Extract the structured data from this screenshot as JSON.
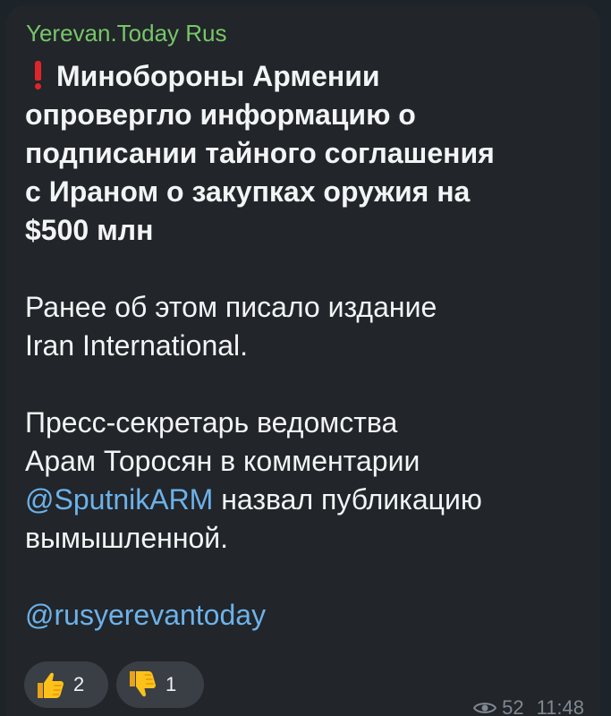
{
  "channel": {
    "name": "Yerevan.Today Rus",
    "name_color": "#77c66a"
  },
  "message": {
    "alert_icon": "red-exclamation-icon",
    "headline_lines": [
      "Минобороны Армении",
      "опровергло информацию о",
      "подписании тайного соглашения",
      "с Ираном о закупках оружия на",
      "$500 млн"
    ],
    "para2_lines": [
      "Ранее об этом писало издание",
      "Iran International."
    ],
    "para3": {
      "line1": "Пресс-секретарь ведомства",
      "line2": "Арам Торосян в комментарии",
      "mention": "@SputnikARM",
      "line3_rest": " назвал публикацию",
      "line4": "вымышленной."
    },
    "signature": "@rusyerevantoday",
    "link_color": "#6cb2ea"
  },
  "reactions": [
    {
      "icon": "thumbs-up-icon",
      "count": "2"
    },
    {
      "icon": "thumbs-down-icon",
      "count": "1"
    }
  ],
  "meta": {
    "views_icon": "eye-icon",
    "views": "52",
    "time": "11:48"
  }
}
